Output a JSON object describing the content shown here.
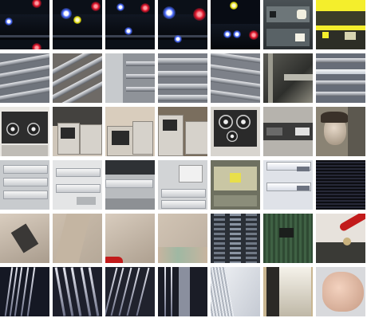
{
  "mosaic": {
    "rows": 6,
    "columns": 7,
    "subjects": [
      [
        "dark-panel-leds",
        "dark-panel-leds",
        "dark-panel-leds",
        "dark-panel-leds",
        "dark-panel-leds",
        "device-closeup",
        "yellow-panel"
      ],
      [
        "rack-units",
        "rack-units",
        "rack-units",
        "rack-units",
        "rack-units",
        "rack-closeup",
        "rack-units"
      ],
      [
        "reel-to-reel",
        "terminals",
        "terminals",
        "terminals",
        "reel-to-reel",
        "computer-room",
        "person-with-machine"
      ],
      [
        "rack-fronts",
        "rack-fronts",
        "rack-fronts",
        "rack-fronts",
        "circuit-board",
        "rack-fronts",
        "dark-grille"
      ],
      [
        "beige-chip",
        "beige-closeup",
        "beige-closeup",
        "beige-closeup",
        "rack-cables",
        "pcb",
        "red-wire-probe"
      ],
      [
        "cable-bundle",
        "cable-bundle",
        "cable-bundle",
        "cable-bundle",
        "white-panel",
        "dark-edge",
        "hand-closeup"
      ]
    ]
  }
}
